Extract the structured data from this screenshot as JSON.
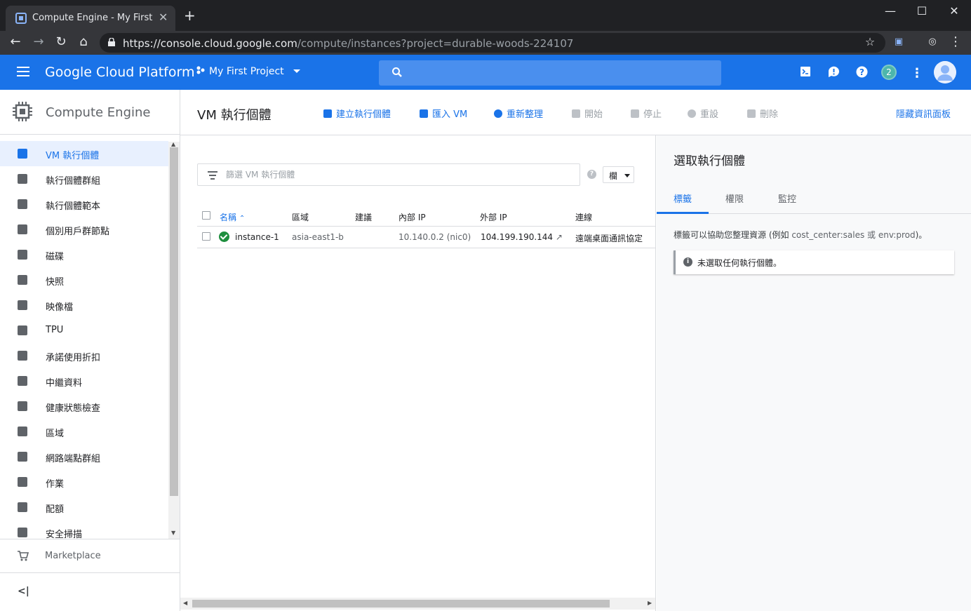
{
  "browser": {
    "tab_title": "Compute Engine - My First Proj",
    "url_host": "https://console.cloud.google.com",
    "url_path": "/compute/instances?project=durable-woods-224107"
  },
  "header": {
    "title": "Google Cloud Platform",
    "project": "My First Project",
    "notifications_count": "2",
    "brand_color": "#1a73e8"
  },
  "sidebar": {
    "product": "Compute Engine",
    "items": [
      {
        "label": "VM 執行個體",
        "icon": "vm-instance-icon"
      },
      {
        "label": "執行個體群組",
        "icon": "instance-group-icon"
      },
      {
        "label": "執行個體範本",
        "icon": "instance-template-icon"
      },
      {
        "label": "個別用戶群節點",
        "icon": "sole-tenant-icon"
      },
      {
        "label": "磁碟",
        "icon": "disk-icon"
      },
      {
        "label": "快照",
        "icon": "snapshot-icon"
      },
      {
        "label": "映像檔",
        "icon": "image-icon"
      },
      {
        "label": "TPU",
        "icon": "tpu-icon"
      },
      {
        "label": "承諾使用折扣",
        "icon": "discount-icon"
      },
      {
        "label": "中繼資料",
        "icon": "metadata-icon"
      },
      {
        "label": "健康狀態檢查",
        "icon": "health-check-icon"
      },
      {
        "label": "區域",
        "icon": "zones-icon"
      },
      {
        "label": "網路端點群組",
        "icon": "network-endpoint-icon"
      },
      {
        "label": "作業",
        "icon": "operations-icon"
      },
      {
        "label": "配額",
        "icon": "quotas-icon"
      },
      {
        "label": "安全掃描",
        "icon": "security-scan-icon"
      }
    ],
    "marketplace": "Marketplace"
  },
  "toolbar": {
    "title": "VM 執行個體",
    "create": "建立執行個體",
    "import": "匯入 VM",
    "refresh": "重新整理",
    "start": "開始",
    "stop": "停止",
    "reset": "重設",
    "delete": "刪除",
    "hide_panel": "隱藏資訊面板"
  },
  "filter": {
    "placeholder": "篩選 VM 執行個體",
    "columns_button": "欄"
  },
  "table": {
    "columns": [
      "名稱",
      "區域",
      "建議",
      "內部 IP",
      "外部 IP",
      "連線"
    ],
    "rows": [
      {
        "name": "instance-1",
        "zone": "asia-east1-b",
        "recommendation": "",
        "internal_ip": "10.140.0.2 (nic0)",
        "external_ip": "104.199.190.144",
        "connect": "遠端桌面通訊協定"
      }
    ]
  },
  "panel": {
    "title": "選取執行個體",
    "tabs": [
      "標籤",
      "權限",
      "監控"
    ],
    "description_prefix": "標籤可以協助您整理資源 (例如",
    "description_code": "cost_center:sales 或 env:prod",
    "description_suffix": ")。",
    "info": "未選取任何執行個體。"
  }
}
